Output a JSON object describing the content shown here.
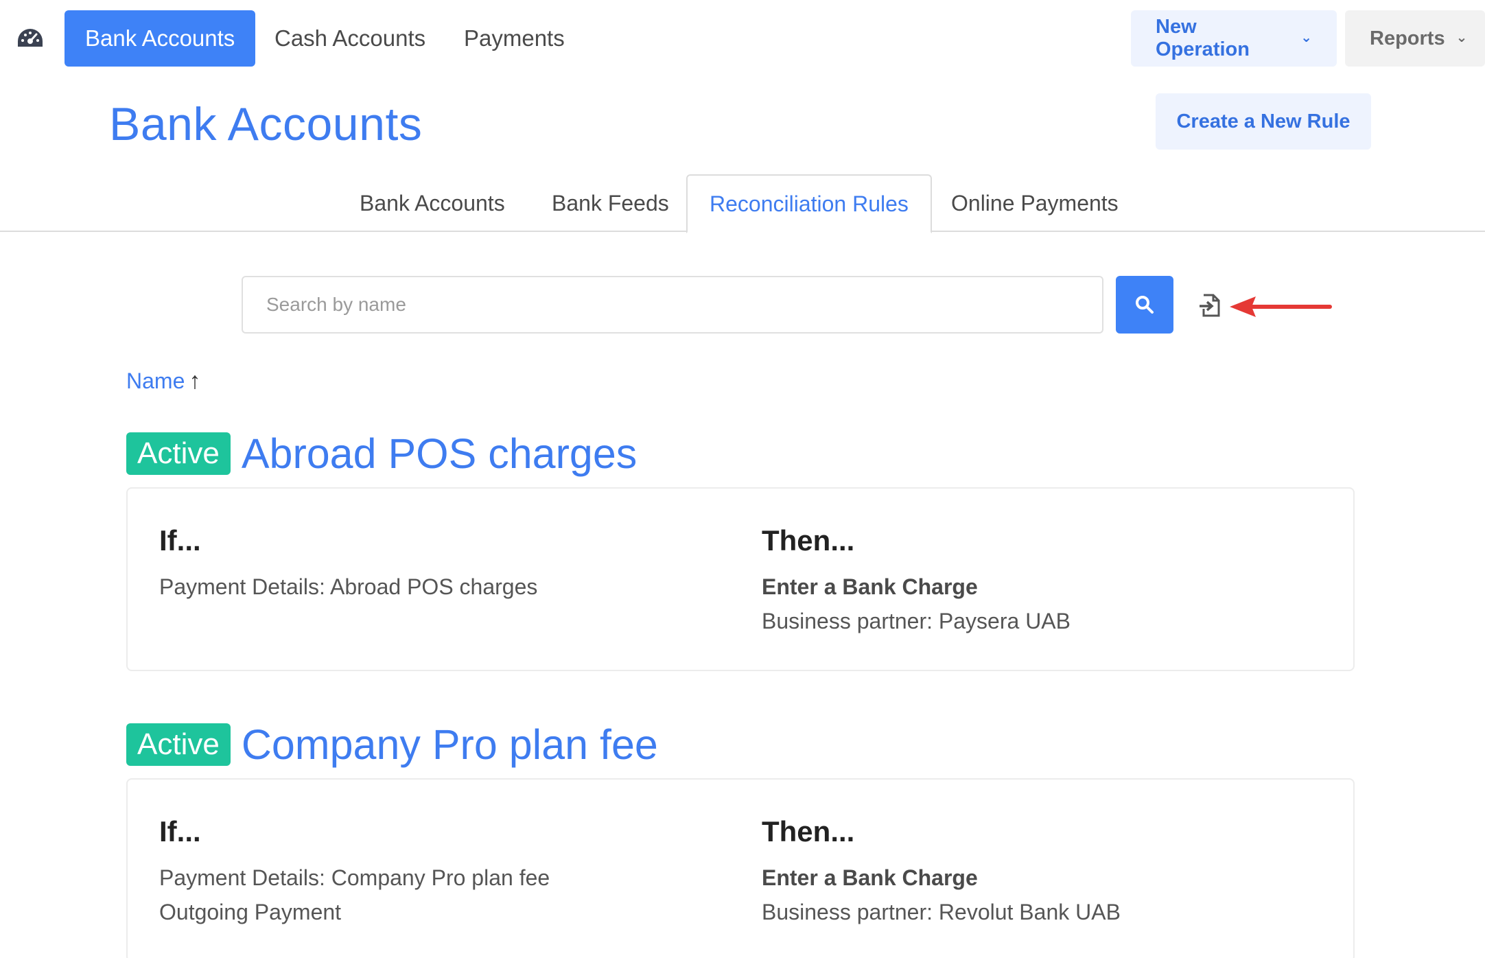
{
  "navbar": {
    "logo_icon": "speedometer-icon",
    "items": [
      {
        "label": "Bank Accounts",
        "active": true
      },
      {
        "label": "Cash Accounts",
        "active": false
      },
      {
        "label": "Payments",
        "active": false
      }
    ],
    "new_operation_label": "New Operation",
    "reports_label": "Reports"
  },
  "page": {
    "title": "Bank Accounts",
    "create_rule_label": "Create a New Rule"
  },
  "tabs": [
    {
      "label": "Bank Accounts",
      "active": false
    },
    {
      "label": "Bank Feeds",
      "active": false
    },
    {
      "label": "Reconciliation Rules",
      "active": true
    },
    {
      "label": "Online Payments",
      "active": false
    }
  ],
  "search": {
    "placeholder": "Search by name",
    "value": "",
    "button_icon": "search-icon",
    "export_icon": "file-import-icon"
  },
  "sort": {
    "label": "Name",
    "direction": "↑"
  },
  "rules": [
    {
      "status": "Active",
      "name": "Abroad POS charges",
      "if_title": "If...",
      "then_title": "Then...",
      "conditions": [
        "Payment Details: Abroad POS charges"
      ],
      "action": "Enter a Bank Charge",
      "details": [
        "Business partner: Paysera UAB"
      ]
    },
    {
      "status": "Active",
      "name": "Company Pro plan fee",
      "if_title": "If...",
      "then_title": "Then...",
      "conditions": [
        "Payment Details: Company Pro plan fee",
        "Outgoing Payment"
      ],
      "action": "Enter a Bank Charge",
      "details": [
        "Business partner: Revolut Bank UAB"
      ]
    }
  ],
  "colors": {
    "primary": "#3e82f7",
    "link": "#3e7cf0",
    "badge": "#1ec49c",
    "annotation_arrow": "#e53935"
  }
}
